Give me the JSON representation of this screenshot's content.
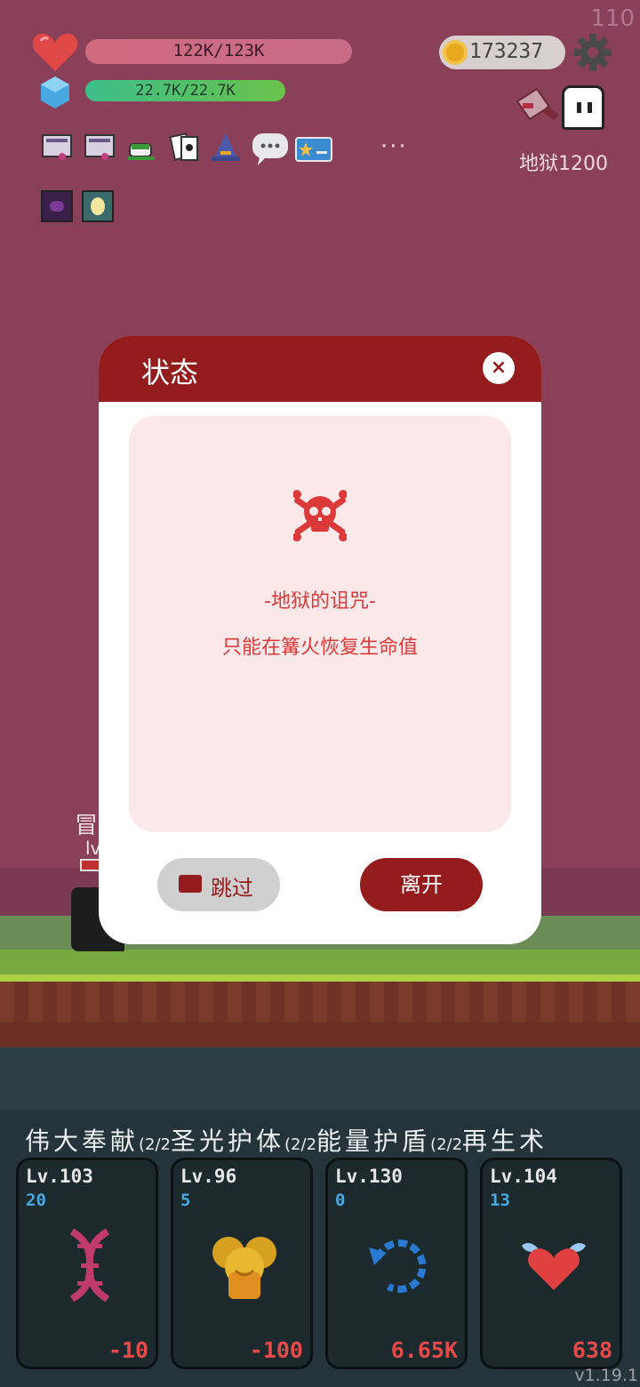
{
  "hud": {
    "fps": "110",
    "hp_text": "122K/123K",
    "mp_text": "22.7K/22.7K",
    "coins": "173237",
    "hell_level": "地狱1200",
    "more": "···"
  },
  "buffs": [
    "scroll-icon",
    "scroll-icon",
    "tea-icon",
    "cards-icon",
    "wizard-hat-icon",
    "speech-bubble-icon",
    "id-card-icon"
  ],
  "hero": {
    "name": "冒",
    "level": "lv"
  },
  "skills": {
    "names_text": "伟大奉献",
    "names": [
      {
        "name": "伟大奉献",
        "sub": "(2/2"
      },
      {
        "name": "圣光护体",
        "sub": "(2/2"
      },
      {
        "name": "能量护盾",
        "sub": "(2/2"
      },
      {
        "name": "再生术",
        "sub": ""
      }
    ],
    "cards": [
      {
        "level": "Lv.103",
        "count": "20",
        "value": "-10",
        "icon": "dna-icon"
      },
      {
        "level": "Lv.96",
        "count": "5",
        "value": "-100",
        "icon": "holy-shield-icon"
      },
      {
        "level": "Lv.130",
        "count": "0",
        "value": "6.65K",
        "icon": "refresh-icon"
      },
      {
        "level": "Lv.104",
        "count": "13",
        "value": "638",
        "icon": "winged-heart-icon"
      }
    ]
  },
  "dialog": {
    "title": "状态",
    "close": "×",
    "curse_title": "-地狱的诅咒-",
    "curse_desc": "只能在篝火恢复生命值",
    "skip_label": "跳过",
    "leave_label": "离开"
  },
  "version": "v1.19.1",
  "colors": {
    "accent": "#951c1c",
    "curse_text": "#dc3a3a",
    "panel": "#fbe8e8",
    "background": "#8a4058"
  }
}
